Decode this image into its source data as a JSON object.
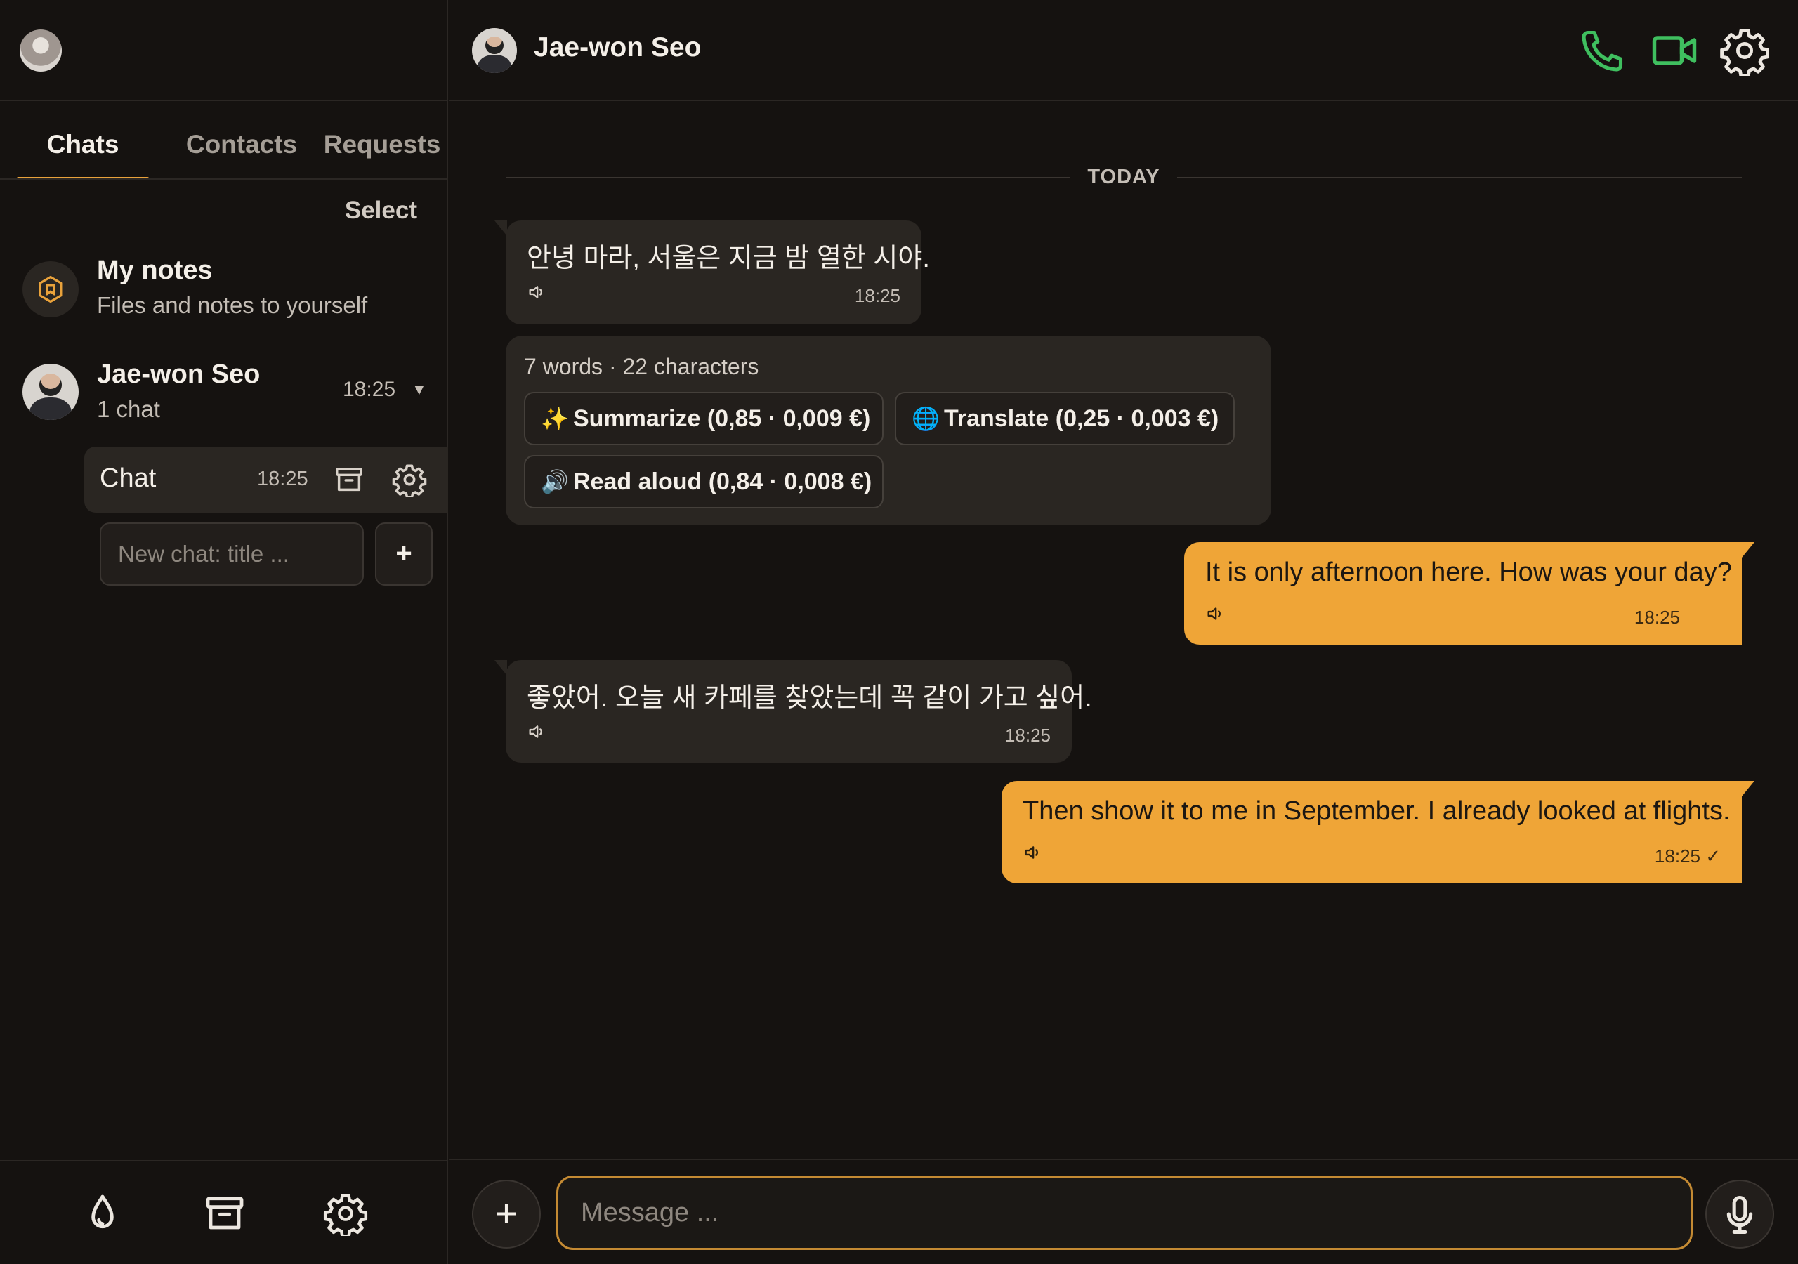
{
  "sidebar": {
    "tabs": [
      {
        "label": "Chats"
      },
      {
        "label": "Contacts"
      },
      {
        "label": "Requests"
      }
    ],
    "select_label": "Select",
    "notes": {
      "title": "My notes",
      "subtitle": "Files and notes to yourself"
    },
    "contact": {
      "name": "Jae-won Seo",
      "subtitle": "1 chat",
      "time": "18:25"
    },
    "chat": {
      "label": "Chat",
      "time": "18:25"
    },
    "new_chat_placeholder": "New chat: title ...",
    "new_chat_add": "+"
  },
  "header": {
    "name": "Jae-won Seo"
  },
  "day_separator": "TODAY",
  "messages": [
    {
      "direction": "in",
      "text": "안녕 마라, 서울은 지금 밤 열한 시야.",
      "time": "18:25"
    },
    {
      "direction": "out",
      "text": "It is only afternoon here. How was your day?",
      "time": "18:25"
    },
    {
      "direction": "in",
      "text": "좋았어. 오늘 새 카페를 찾았는데 꼭 같이 가고 싶어.",
      "time": "18:25"
    },
    {
      "direction": "out",
      "text": "Then show it to me in September. I already looked at flights.",
      "time": "18:25 ✓"
    }
  ],
  "ai_panel": {
    "stats": "7 words · 22 characters",
    "actions": [
      {
        "icon": "✨",
        "label": "Summarize (0,85 · 0,009 €)"
      },
      {
        "icon": "🌐",
        "label": "Translate (0,25 · 0,003 €)"
      },
      {
        "icon": "🔊",
        "label": "Read aloud (0,84 · 0,008 €)"
      }
    ]
  },
  "composer": {
    "placeholder": "Message ...",
    "plus": "+"
  },
  "colors": {
    "accent": "#efa537",
    "call_green": "#3fbf5f",
    "background": "#151210",
    "bubble_in": "#2a2622"
  }
}
